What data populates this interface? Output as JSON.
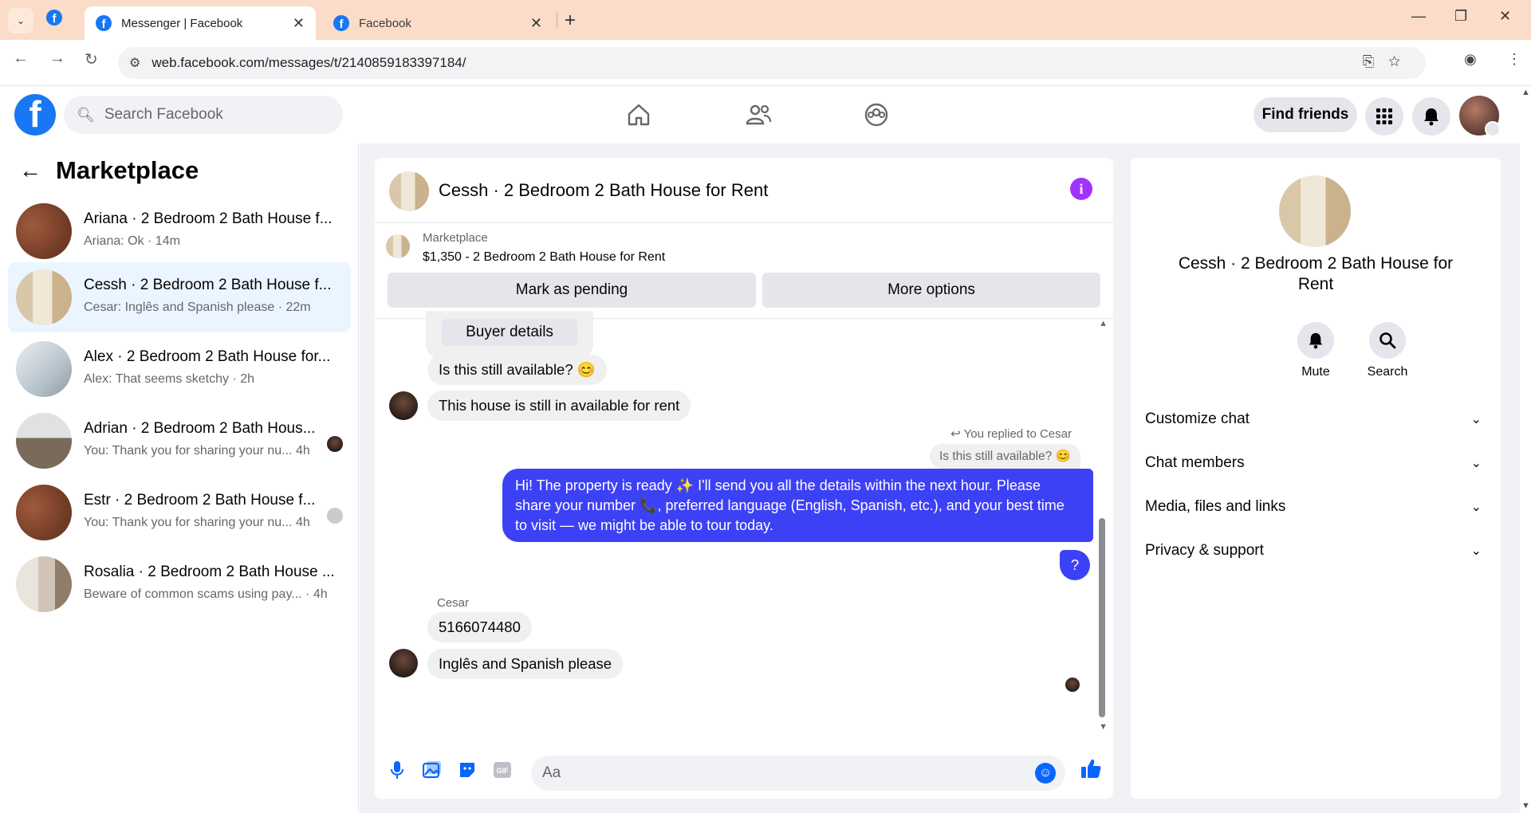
{
  "browser": {
    "tabs": [
      {
        "title": "Messenger | Facebook",
        "active": true
      },
      {
        "title": "Facebook",
        "active": false
      }
    ],
    "url": "web.facebook.com/messages/t/2140859183397184/"
  },
  "header": {
    "search_placeholder": "Search Facebook",
    "find_friends": "Find friends"
  },
  "sidebar": {
    "title": "Marketplace",
    "conversations": [
      {
        "name": "Ariana · 2 Bedroom 2 Bath House f...",
        "preview": "Ariana: Ok · 14m"
      },
      {
        "name": "Cessh · 2 Bedroom 2 Bath House f...",
        "preview": "Cesar: Inglês and Spanish please · 22m"
      },
      {
        "name": "Alex · 2 Bedroom 2 Bath House for...",
        "preview": "Alex: That seems sketchy · 2h"
      },
      {
        "name": "Adrian · 2 Bedroom 2 Bath Hous...",
        "preview": "You: Thank you for sharing your nu... 4h"
      },
      {
        "name": "Estr · 2 Bedroom 2 Bath House f...",
        "preview": "You: Thank you for sharing your nu... 4h"
      },
      {
        "name": "Rosalia · 2 Bedroom 2 Bath House ...",
        "preview": "Beware of common scams using pay... · 4h"
      }
    ]
  },
  "chat": {
    "title": "Cessh · 2 Bedroom 2 Bath House for Rent",
    "listing_label": "Marketplace",
    "listing_price": "$1,350 - 2 Bedroom 2 Bath House for Rent",
    "mark_pending": "Mark as pending",
    "more_options": "More options",
    "buyer_details": "Buyer details",
    "messages": {
      "m1": "Is this still available? 😊",
      "m2": "This house is still in available for rent",
      "reply_label": "You replied to Cesar",
      "reply_quote": "Is this still available? 😊",
      "m3_line1": "Hi! The property is ready ✨ I'll send you all the details within the next hour. Please",
      "m3_line2": "share your number 📞, preferred language (English, Spanish, etc.), and your best time",
      "m3_line3": "to visit — we might be able to tour today.",
      "m4": "?",
      "sender": "Cesar",
      "m5": "5166074480",
      "m6": "Inglês and Spanish please"
    },
    "composer_placeholder": "Aa"
  },
  "right_panel": {
    "name": "Cessh · 2 Bedroom 2 Bath House for Rent",
    "mute": "Mute",
    "search": "Search",
    "sections": [
      "Customize chat",
      "Chat members",
      "Media, files and links",
      "Privacy & support"
    ]
  },
  "colors": {
    "fb_blue": "#1877f2",
    "outgoing_bubble": "#3d41f5",
    "selected_row": "#ebf5ff",
    "info_purple": "#a033ff"
  }
}
